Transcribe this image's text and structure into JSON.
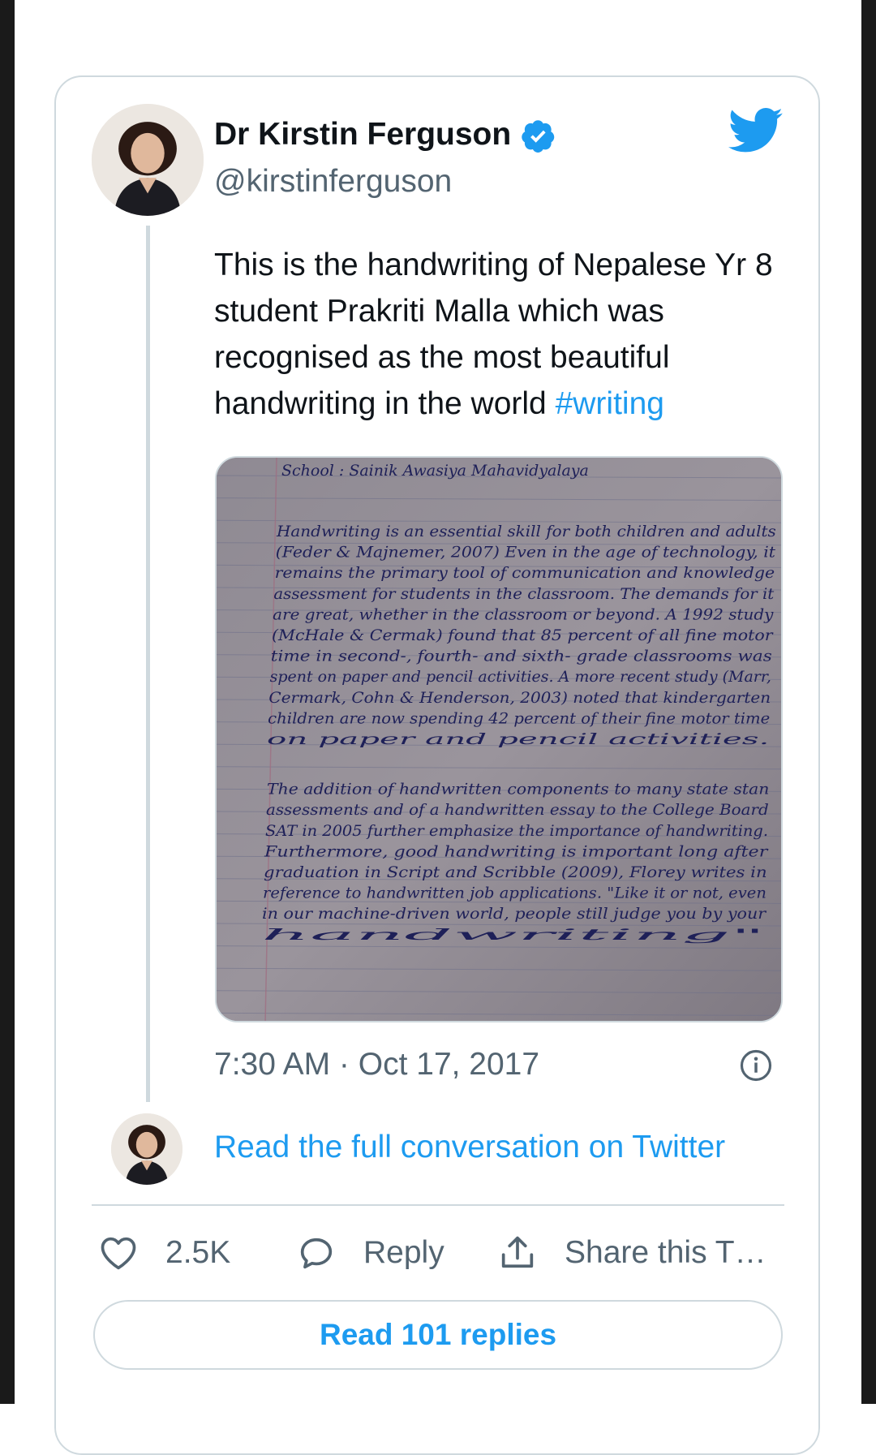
{
  "colors": {
    "accent": "#1d9bf0",
    "text": "#0f1419",
    "muted": "#536471",
    "border": "#cfd9de"
  },
  "author": {
    "name": "Dr Kirstin Ferguson",
    "handle": "@kirstinferguson",
    "verified": true,
    "avatar_icon": "person-avatar"
  },
  "tweet": {
    "text": "This is the handwriting of Nepalese Yr 8 student Prakriti Malla which was recognised as the most beautiful handwriting in the world ",
    "hashtag": "#writing",
    "timestamp": "7:30 AM · Oct 17, 2017",
    "media": {
      "school_line": "School : Sainik Awasiya Mahavidyalaya",
      "paragraph_1": [
        "Handwriting is an essential skill for both children and adults",
        "(Feder & Majnemer, 2007) Even in the age of technology, it",
        "remains the primary tool of communication and knowledge",
        "assessment for students in the classroom. The demands for it",
        "are great, whether in the classroom or beyond. A 1992 study",
        "(McHale & Cermak) found that 85 percent of all fine motor",
        "time in second-, fourth- and sixth- grade classrooms was",
        "spent on paper and pencil activities. A more recent study (Marr,",
        "Cermark, Cohn & Henderson, 2003) noted that kindergarten",
        "children are now spending 42 percent of their fine motor time",
        "on paper and pencil activities."
      ],
      "paragraph_2": [
        "The addition of handwritten components to many state stan",
        "assessments and of a handwritten essay to the College Board",
        "SAT in 2005 further emphasize the importance of handwriting.",
        "Furthermore, good handwriting is important long after",
        "graduation in Script and Scribble (2009), Florey writes in",
        "reference to handwritten job applications. \"Like it or not, even",
        "in our machine-driven world, people still judge you by your",
        "handwriting\""
      ]
    }
  },
  "links": {
    "read_conversation": "Read the full conversation on Twitter"
  },
  "actions": {
    "like_count": "2.5K",
    "reply_label": "Reply",
    "share_label": "Share this T…",
    "read_replies": "Read 101 replies"
  },
  "icons": [
    "verified-icon",
    "twitter-bird-icon",
    "info-icon",
    "heart-icon",
    "reply-bubble-icon",
    "share-icon"
  ]
}
